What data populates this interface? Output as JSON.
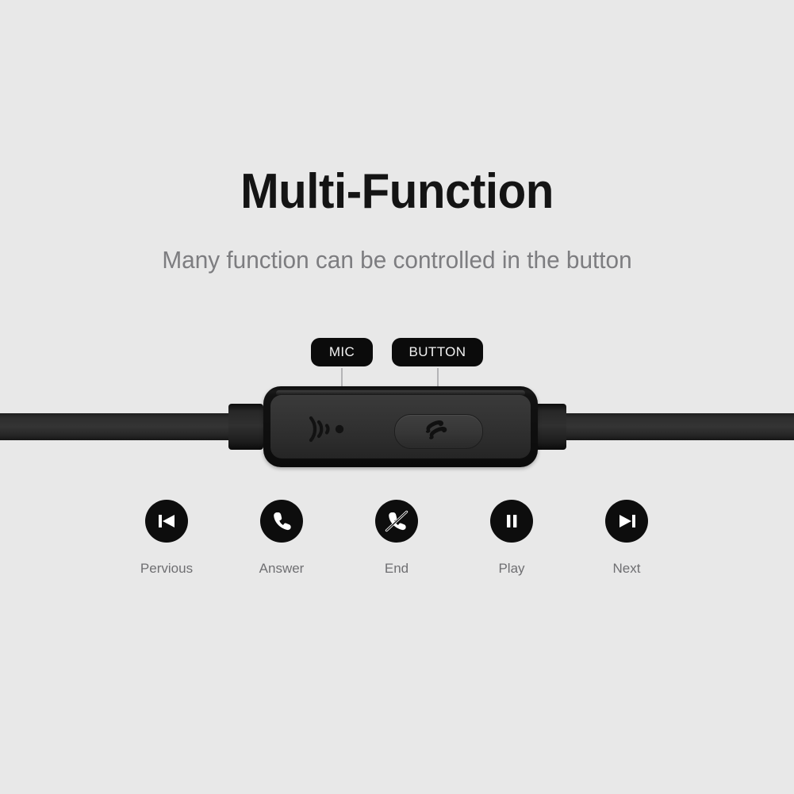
{
  "page": {
    "background_color": "#e8e8e8",
    "title": "Multi-Function",
    "subtitle": "Many function can be controlled in the button"
  },
  "colors": {
    "background": "#e8e8e8",
    "title_text": "#141414",
    "subtitle_text": "#7d7d80",
    "badge_background": "#0b0b0b",
    "badge_text": "#f2f2f2",
    "leader_line": "#b4b4b6",
    "cable_black": "#2e2e2e",
    "module_black": "#121212",
    "module_face": "#343434",
    "icon_circle": "#0d0d0d",
    "icon_glyph": "#ffffff",
    "caption_text": "#6f6f72"
  },
  "callouts": [
    {
      "id": "mic",
      "label": "MIC",
      "icon": "mic-waves-icon"
    },
    {
      "id": "button",
      "label": "BUTTON",
      "icon": "call-button-icon"
    }
  ],
  "product": {
    "component": "inline-remote-control-module",
    "cable": "flat-audio-cable",
    "mic_icon": "mic-waves-icon",
    "call_button_icon": "phone-handset-icon"
  },
  "functions": [
    {
      "label": "Pervious",
      "icon": "skip-previous-icon"
    },
    {
      "label": "Answer",
      "icon": "phone-answer-icon"
    },
    {
      "label": "End",
      "icon": "phone-hangup-icon"
    },
    {
      "label": "Play",
      "icon": "pause-icon"
    },
    {
      "label": "Next",
      "icon": "skip-next-icon"
    }
  ]
}
